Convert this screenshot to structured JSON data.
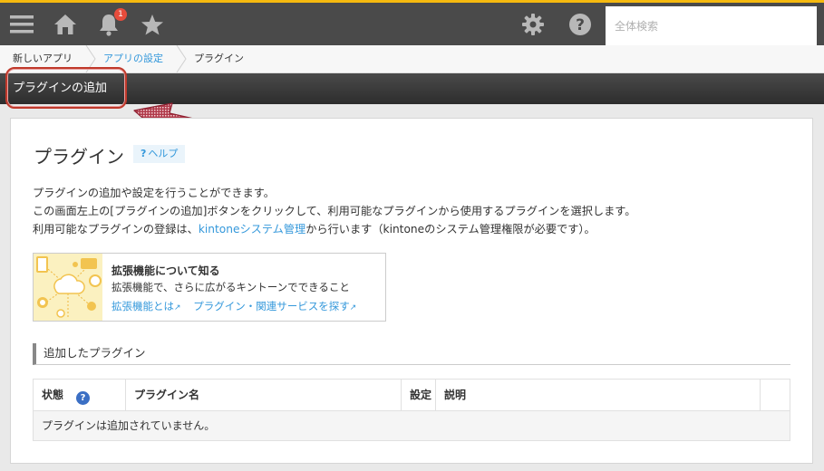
{
  "header": {
    "notification_count": "1",
    "search_placeholder": "全体検索",
    "icons": [
      "menu-icon",
      "home-icon",
      "bell-icon",
      "star-icon",
      "gear-icon",
      "help-icon"
    ],
    "accent_color": "#f5b90f",
    "bar_color": "#4a4a4a"
  },
  "breadcrumb": {
    "items": [
      {
        "label": "新しいアプリ"
      },
      {
        "label": "アプリの設定"
      },
      {
        "label": "プラグイン"
      }
    ]
  },
  "actionbar": {
    "add_plugin_label": "プラグインの追加"
  },
  "main": {
    "title": "プラグイン",
    "help_label": "ヘルプ",
    "help_mark": "?",
    "desc_line1": "プラグインの追加や設定を行うことができます。",
    "desc_line2": "この画面左上の[プラグインの追加]ボタンをクリックして、利用可能なプラグインから使用するプラグインを選択します。",
    "desc_line3_pre": "利用可能なプラグインの登録は、",
    "desc_line3_link": "kintoneシステム管理",
    "desc_line3_post": "から行います（kintoneのシステム管理権限が必要です）。",
    "info": {
      "title": "拡張機能について知る",
      "subtitle": "拡張機能で、さらに広がるキントーンでできること",
      "link1": "拡張機能とは",
      "link2": "プラグイン・関連サービスを探す",
      "ext_mark": "↗"
    },
    "section_title": "追加したプラグイン",
    "table": {
      "headers": [
        "状態",
        "プラグイン名",
        "設定",
        "説明"
      ],
      "status_help_mark": "?",
      "empty_message": "プラグインは追加されていません。"
    }
  },
  "colors": {
    "link": "#3498db",
    "highlight": "#c0392b",
    "badge": "#e74c3c"
  }
}
